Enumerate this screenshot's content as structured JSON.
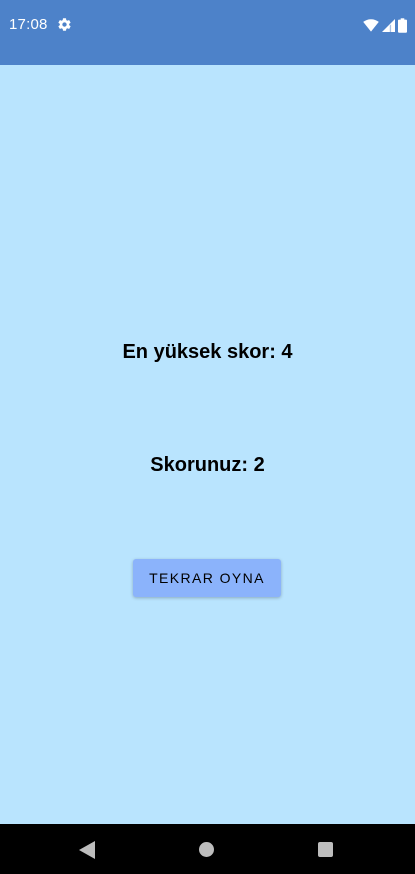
{
  "status_bar": {
    "time": "17:08",
    "icons": [
      "settings-gear-icon",
      "wifi-icon",
      "signal-icon",
      "battery-icon"
    ]
  },
  "game_over": {
    "high_score_text": "En yüksek skor: 4",
    "your_score_text": "Skorunuz: 2",
    "play_again_label": "TEKRAR OYNA"
  },
  "nav_bar": {
    "icons": [
      "back-icon",
      "home-icon",
      "recents-icon"
    ]
  },
  "colors": {
    "status_bar": "#4d82c9",
    "background": "#b9e4fe",
    "button": "#8bb3fb",
    "nav_bar": "#000000"
  }
}
